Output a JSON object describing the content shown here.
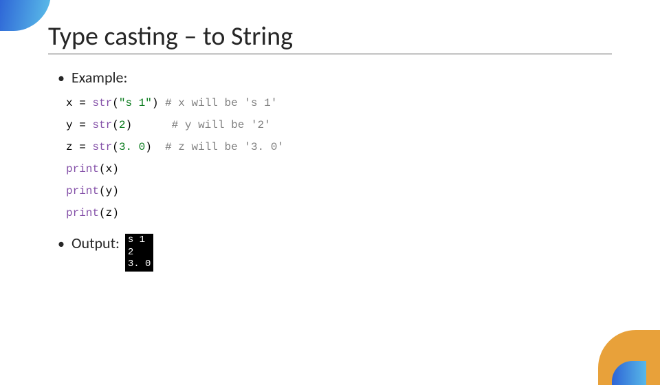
{
  "title": "Type casting – to String",
  "sections": {
    "example_label": "Example:",
    "output_label": "Output:"
  },
  "code": {
    "l1_var": "x",
    "l1_eq": " = ",
    "l1_fn": "str",
    "l1_arg_open": "(",
    "l1_arg": "\"s 1\"",
    "l1_arg_close": ")",
    "l1_pad": " ",
    "l1_cmt": "# x will be 's 1'",
    "l2_var": "y",
    "l2_eq": " = ",
    "l2_fn": "str",
    "l2_arg_open": "(",
    "l2_arg": "2",
    "l2_arg_close": ")",
    "l2_pad": "      ",
    "l2_cmt": "# y will be '2'",
    "l3_var": "z",
    "l3_eq": " = ",
    "l3_fn": "str",
    "l3_arg_open": "(",
    "l3_arg": "3. 0",
    "l3_arg_close": ")",
    "l3_pad": "  ",
    "l3_cmt": "# z will be '3. 0'",
    "p1_fn": "print",
    "p1_arg": "(x)",
    "p2_fn": "print",
    "p2_arg": "(y)",
    "p3_fn": "print",
    "p3_arg": "(z)"
  },
  "output": {
    "line1": "s 1",
    "line2": "2",
    "line3": "3. 0"
  }
}
